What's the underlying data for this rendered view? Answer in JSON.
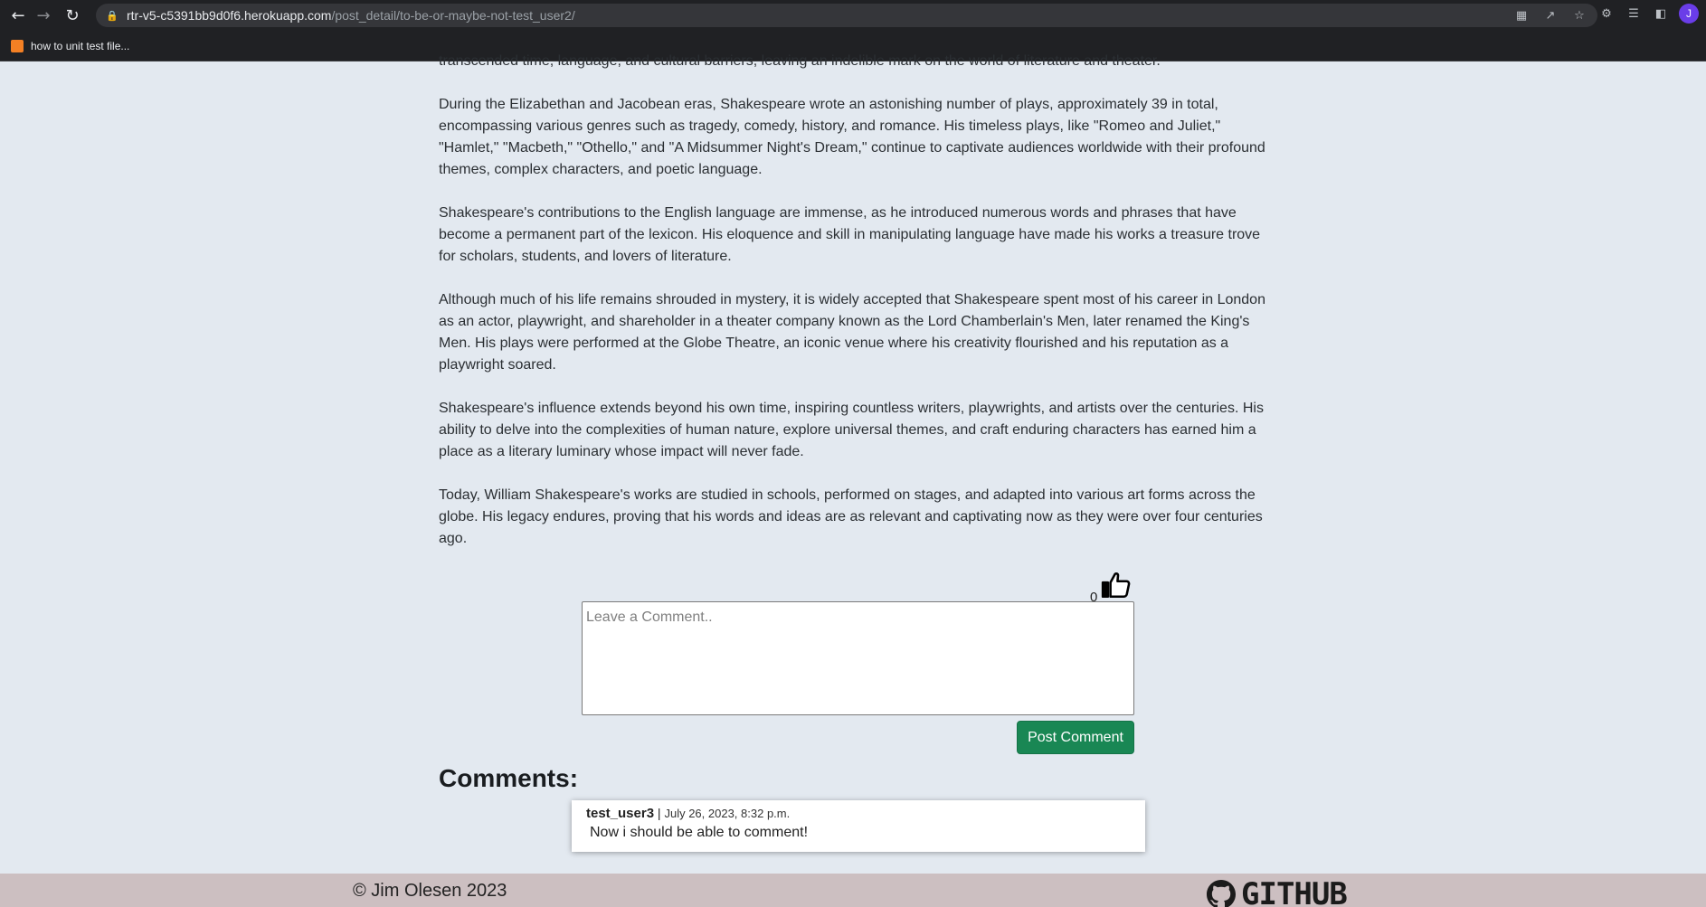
{
  "browser": {
    "url_host": "rtr-v5-c5391bb9d0f6.herokuapp.com",
    "url_path": "/post_detail/to-be-or-maybe-not-test_user2/",
    "profile_initial": "J",
    "bookmark_label": "how to unit test file..."
  },
  "article": {
    "paragraphs": [
      "transcended time, language, and cultural barriers, leaving an indelible mark on the world of literature and theater.",
      "During the Elizabethan and Jacobean eras, Shakespeare wrote an astonishing number of plays, approximately 39 in total, encompassing various genres such as tragedy, comedy, history, and romance. His timeless plays, like \"Romeo and Juliet,\" \"Hamlet,\" \"Macbeth,\" \"Othello,\" and \"A Midsummer Night's Dream,\" continue to captivate audiences worldwide with their profound themes, complex characters, and poetic language.",
      "Shakespeare's contributions to the English language are immense, as he introduced numerous words and phrases that have become a permanent part of the lexicon. His eloquence and skill in manipulating language have made his works a treasure trove for scholars, students, and lovers of literature.",
      "Although much of his life remains shrouded in mystery, it is widely accepted that Shakespeare spent most of his career in London as an actor, playwright, and shareholder in a theater company known as the Lord Chamberlain's Men, later renamed the King's Men. His plays were performed at the Globe Theatre, an iconic venue where his creativity flourished and his reputation as a playwright soared.",
      "Shakespeare's influence extends beyond his own time, inspiring countless writers, playwrights, and artists over the centuries. His ability to delve into the complexities of human nature, explore universal themes, and craft enduring characters has earned him a place as a literary luminary whose impact will never fade.",
      "Today, William Shakespeare's works are studied in schools, performed on stages, and adapted into various art forms across the globe. His legacy endures, proving that his words and ideas are as relevant and captivating now as they were over four centuries ago."
    ]
  },
  "likes": {
    "count": "0"
  },
  "comment_form": {
    "placeholder": "Leave a Comment..",
    "value": "",
    "submit_label": "Post Comment"
  },
  "comments": {
    "heading": "Comments:",
    "items": [
      {
        "author": "test_user3",
        "separator": " | ",
        "date": "July 26, 2023, 8:32 p.m.",
        "body": "Now i should be able to comment!"
      }
    ]
  },
  "footer": {
    "copyright": "© Jim Olesen 2023",
    "github_label": "GITHUB"
  }
}
